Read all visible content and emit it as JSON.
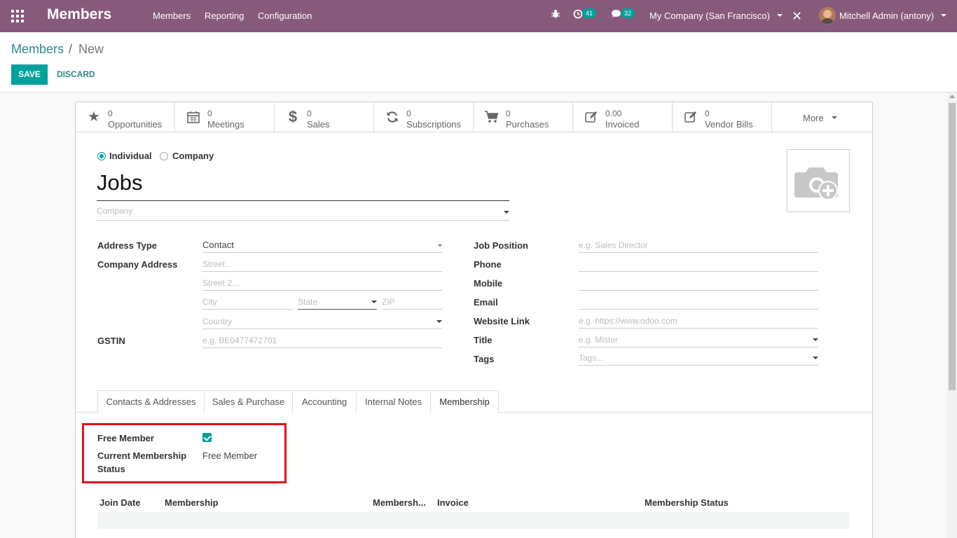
{
  "navbar": {
    "brand": "Members",
    "menu": [
      "Members",
      "Reporting",
      "Configuration"
    ],
    "activity_badge": "41",
    "message_badge": "32",
    "company": "My Company (San Francisco)",
    "user": "Mitchell Admin (antony)"
  },
  "breadcrumb": {
    "root": "Members",
    "separator": "/",
    "current": "New"
  },
  "buttons": {
    "save": "SAVE",
    "discard": "DISCARD"
  },
  "smart_buttons": [
    {
      "value": "0",
      "label": "Opportunities",
      "icon": "star-icon"
    },
    {
      "value": "0",
      "label": "Meetings",
      "icon": "calendar-icon"
    },
    {
      "value": "0",
      "label": "Sales",
      "icon": "dollar-icon"
    },
    {
      "value": "0",
      "label": "Subscriptions",
      "icon": "refresh-icon"
    },
    {
      "value": "0",
      "label": "Purchases",
      "icon": "cart-icon"
    },
    {
      "value": "0.00",
      "label": "Invoiced",
      "icon": "edit-icon"
    },
    {
      "value": "0",
      "label": "Vendor Bills",
      "icon": "edit-icon"
    }
  ],
  "more_label": "More",
  "type_options": {
    "individual": "Individual",
    "company": "Company"
  },
  "name": "Jobs",
  "company_placeholder": "Company",
  "left_fields": {
    "address_type_label": "Address Type",
    "address_type_value": "Contact",
    "company_address_label": "Company Address",
    "street_ph": "Street...",
    "street2_ph": "Street 2...",
    "city_ph": "City",
    "state_ph": "State",
    "zip_ph": "ZIP",
    "country_ph": "Country",
    "gstin_label": "GSTIN",
    "gstin_ph": "e.g. BE0477472701"
  },
  "right_fields": {
    "job_position_label": "Job Position",
    "job_position_ph": "e.g. Sales Director",
    "phone_label": "Phone",
    "mobile_label": "Mobile",
    "email_label": "Email",
    "website_label": "Website Link",
    "website_ph": "e.g. https://www.odoo.com",
    "title_label": "Title",
    "title_ph": "e.g. Mister",
    "tags_label": "Tags",
    "tags_ph": "Tags..."
  },
  "tabs": [
    "Contacts & Addresses",
    "Sales & Purchase",
    "Accounting",
    "Internal Notes",
    "Membership"
  ],
  "membership": {
    "free_member_label": "Free Member",
    "free_member_checked": true,
    "status_label_line1": "Current Membership",
    "status_label_line2": "Status",
    "status_value": "Free Member"
  },
  "table_headers": [
    "Join Date",
    "Membership",
    "Membersh...",
    "Invoice",
    "Membership Status"
  ]
}
